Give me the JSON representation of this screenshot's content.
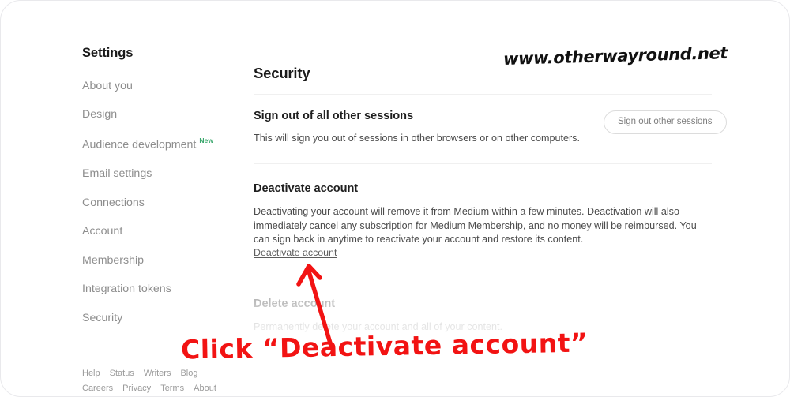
{
  "sidebar": {
    "title": "Settings",
    "items": [
      {
        "label": "About you",
        "badge": ""
      },
      {
        "label": "Design",
        "badge": ""
      },
      {
        "label": "Audience development",
        "badge": "New"
      },
      {
        "label": "Email settings",
        "badge": ""
      },
      {
        "label": "Connections",
        "badge": ""
      },
      {
        "label": "Account",
        "badge": ""
      },
      {
        "label": "Membership",
        "badge": ""
      },
      {
        "label": "Integration tokens",
        "badge": ""
      },
      {
        "label": "Security",
        "badge": ""
      }
    ],
    "footer": {
      "row1": [
        "Help",
        "Status",
        "Writers",
        "Blog"
      ],
      "row2": [
        "Careers",
        "Privacy",
        "Terms",
        "About"
      ]
    }
  },
  "main": {
    "page_title": "Security",
    "sections": {
      "signout": {
        "title": "Sign out of all other sessions",
        "body": "This will sign you out of sessions in other browsers or on other computers.",
        "button_label": "Sign out other sessions"
      },
      "deactivate": {
        "title": "Deactivate account",
        "body": "Deactivating your account will remove it from Medium within a few minutes. Deactivation will also immediately cancel any subscription for Medium Membership, and no money will be reimbursed. You can sign back in anytime to reactivate your account and restore its content.",
        "link_label": "Deactivate account"
      },
      "delete": {
        "title": "Delete account",
        "body": "Permanently delete your account and all of your content."
      }
    }
  },
  "annotations": {
    "watermark": "www.otherwayround.net",
    "instruction": "Click “Deactivate account”",
    "arrow_color": "#f21313",
    "text_color": "#f21313"
  },
  "colors": {
    "accent_red": "#f21313",
    "badge_green": "#3aa76d",
    "nav_gray": "#8d8d8d",
    "text_dark": "#1a1a1a"
  }
}
